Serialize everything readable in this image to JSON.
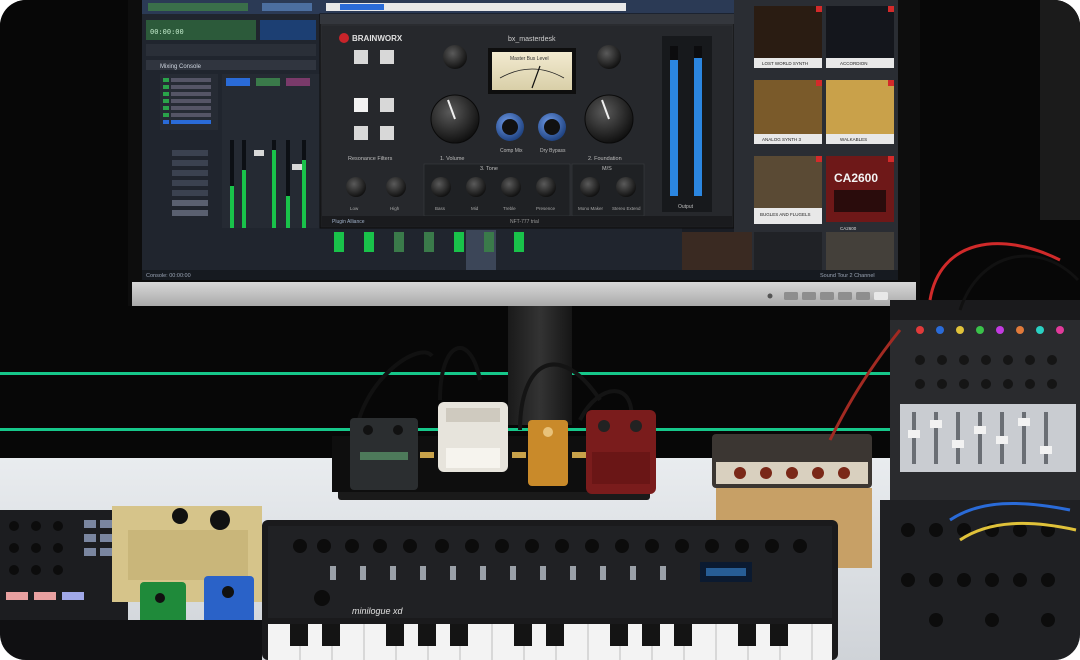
{
  "scene": {
    "screen": {
      "plugin": {
        "brand": "BRAINWORX",
        "preset": "bx_masterdesk",
        "meter_title": "Master Bus Level",
        "knob_labels": [
          "1. Volume",
          "Comp Mix",
          "Dry Bypass",
          "2. Foundation"
        ],
        "section_titles": [
          "Resonance Filters",
          "3. Tone",
          "M/S"
        ],
        "small_knob_labels": [
          "Low",
          "High",
          "Bass",
          "Mid",
          "Treble",
          "Presence",
          "Mono Maker",
          "Stereo Extend"
        ],
        "output_label": "Output",
        "footer_left": "Plugin Alliance",
        "footer_mid": "NFT-777 trial"
      },
      "tiles": [
        {
          "label": "LOST WORLD SYNTH",
          "color": "#2a1c12"
        },
        {
          "label": "ACCORDION",
          "color": "#14161c"
        },
        {
          "label": "ANALOG SYNTH 3",
          "color": "#7a5a2a"
        },
        {
          "label": "WALKABLES",
          "color": "#c9a14a"
        },
        {
          "label": "BUGLES AND FLUGELS",
          "color": "#5a4a34"
        },
        {
          "label": "CA2600",
          "color": "#6e1818"
        }
      ],
      "ca2600_text": "CA2600",
      "mixer_title": "Mixing Console",
      "transport_time": "00:00:00",
      "status_left": "Console: 00:00:00",
      "status_right": "Sound Tour 2 Channel"
    },
    "synth_label": "minilogue xd",
    "accent_green": "#16c78a",
    "ui_blue": "#2a6bd8"
  }
}
